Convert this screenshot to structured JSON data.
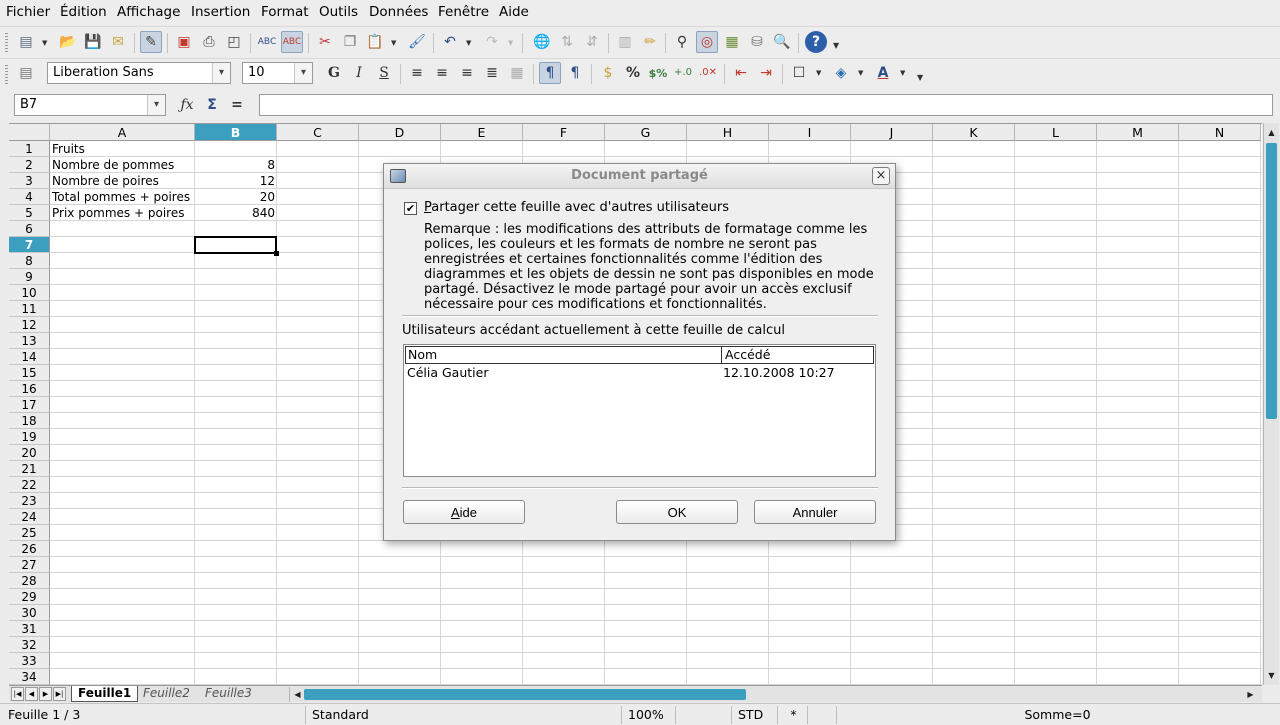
{
  "menubar": {
    "items": [
      "Fichier",
      "Édition",
      "Affichage",
      "Insertion",
      "Format",
      "Outils",
      "Données",
      "Fenêtre",
      "Aide"
    ]
  },
  "formatting": {
    "font_name": "Liberation Sans",
    "font_size": "10",
    "bold_glyph": "G",
    "italic_glyph": "I",
    "underline_glyph": "S"
  },
  "formula_bar": {
    "cell_ref": "B7",
    "input_value": ""
  },
  "sheet": {
    "columns": [
      "A",
      "B",
      "C",
      "D",
      "E",
      "F",
      "G",
      "H",
      "I",
      "J",
      "K",
      "L",
      "M",
      "N"
    ],
    "selected_column": "B",
    "rows": [
      "1",
      "2",
      "3",
      "4",
      "5",
      "6",
      "7",
      "8",
      "9",
      "10",
      "11",
      "12",
      "13",
      "14",
      "15",
      "16",
      "17",
      "18",
      "19",
      "20",
      "21",
      "22",
      "23",
      "24",
      "25",
      "26",
      "27",
      "28",
      "29",
      "30",
      "31",
      "32",
      "33",
      "34"
    ],
    "selected_row": "7",
    "active_cell": "B7",
    "cells": {
      "A1": "Fruits",
      "A2": "Nombre de pommes",
      "B2": "8",
      "A3": "Nombre de poires",
      "B3": "12",
      "A4": "Total pommes + poires",
      "B4": "20",
      "A5": "Prix pommes + poires",
      "B5": "840"
    }
  },
  "tabs": [
    "Feuille1",
    "Feuille2",
    "Feuille3"
  ],
  "active_tab": "Feuille1",
  "statusbar": {
    "sheet": "Feuille 1 / 3",
    "style": "Standard",
    "zoom": "100%",
    "mode": "STD",
    "modified": "*",
    "sum": "Somme=0"
  },
  "dialog": {
    "title": "Document partagé",
    "close_glyph": "×",
    "share_checkbox": {
      "label": "Partager cette feuille avec d'autres utilisateurs",
      "checked": true,
      "check_glyph": "✔"
    },
    "remark": "Remarque : les modifications des attributs de formatage comme les polices, les couleurs et les formats de nombre ne seront pas enregistrées et certaines fonctionnalités comme l'édition des diagrammes et les objets de dessin ne sont pas disponibles en mode partagé. Désactivez le mode partagé pour avoir un accès exclusif nécessaire pour ces modifications et fonctionnalités.",
    "users_label": "Utilisateurs accédant actuellement à cette feuille de calcul",
    "list": {
      "columns": [
        "Nom",
        "Accédé"
      ],
      "rows": [
        {
          "name": "Célia Gautier",
          "accessed": "12.10.2008 10:27"
        }
      ]
    },
    "buttons": {
      "help": "Aide",
      "ok": "OK",
      "cancel": "Annuler"
    }
  },
  "colors": {
    "selection_accent": "#3c9fbf",
    "window_background": "#ececec"
  }
}
